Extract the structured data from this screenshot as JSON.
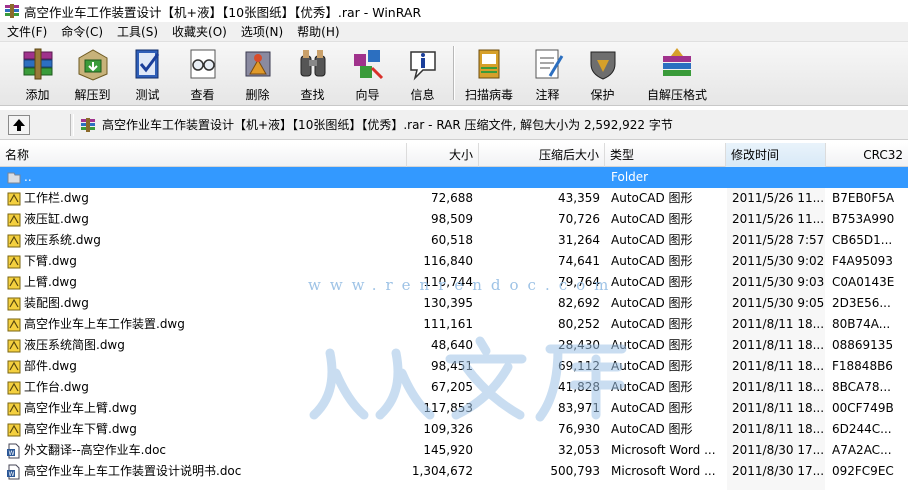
{
  "window": {
    "title": "高空作业车工作装置设计【机+液】【10张图纸】【优秀】.rar - WinRAR"
  },
  "menu": [
    {
      "label": "文件(F)"
    },
    {
      "label": "命令(C)"
    },
    {
      "label": "工具(S)"
    },
    {
      "label": "收藏夹(O)"
    },
    {
      "label": "选项(N)"
    },
    {
      "label": "帮助(H)"
    }
  ],
  "toolbar": [
    {
      "label": "添加",
      "icon": "add-books-icon"
    },
    {
      "label": "解压到",
      "icon": "extract-to-icon"
    },
    {
      "label": "测试",
      "icon": "test-icon"
    },
    {
      "label": "查看",
      "icon": "view-glasses-icon"
    },
    {
      "label": "删除",
      "icon": "delete-icon"
    },
    {
      "label": "查找",
      "icon": "find-binoculars-icon"
    },
    {
      "label": "向导",
      "icon": "wizard-icon"
    },
    {
      "label": "信息",
      "icon": "info-icon"
    },
    {
      "label": "扫描病毒",
      "icon": "virus-scan-icon"
    },
    {
      "label": "注释",
      "icon": "comment-icon"
    },
    {
      "label": "保护",
      "icon": "protect-shield-icon"
    },
    {
      "label": "自解压格式",
      "icon": "sfx-icon"
    }
  ],
  "address": {
    "text": "高空作业车工作装置设计【机+液】【10张图纸】【优秀】.rar - RAR 压缩文件, 解包大小为 2,592,922 字节"
  },
  "columns": {
    "name": "名称",
    "size": "大小",
    "packed": "压缩后大小",
    "type": "类型",
    "modified": "修改时间",
    "crc": "CRC32"
  },
  "rows": [
    {
      "name": "..",
      "size": "",
      "packed": "",
      "type": "Folder",
      "modified": "",
      "crc": "",
      "kind": "folder"
    },
    {
      "name": "工作栏.dwg",
      "size": "72,688",
      "packed": "43,359",
      "type": "AutoCAD 图形",
      "modified": "2011/5/26 11...",
      "crc": "B7EB0F5A",
      "kind": "dwg"
    },
    {
      "name": "液压缸.dwg",
      "size": "98,509",
      "packed": "70,726",
      "type": "AutoCAD 图形",
      "modified": "2011/5/26 11...",
      "crc": "B753A990",
      "kind": "dwg"
    },
    {
      "name": "液压系统.dwg",
      "size": "60,518",
      "packed": "31,264",
      "type": "AutoCAD 图形",
      "modified": "2011/5/28 7:57",
      "crc": "CB65D1...",
      "kind": "dwg"
    },
    {
      "name": "下臂.dwg",
      "size": "116,840",
      "packed": "74,641",
      "type": "AutoCAD 图形",
      "modified": "2011/5/30 9:02",
      "crc": "F4A95093",
      "kind": "dwg"
    },
    {
      "name": "上臂.dwg",
      "size": "110,744",
      "packed": "79,764",
      "type": "AutoCAD 图形",
      "modified": "2011/5/30 9:03",
      "crc": "C0A0143E",
      "kind": "dwg"
    },
    {
      "name": "装配图.dwg",
      "size": "130,395",
      "packed": "82,692",
      "type": "AutoCAD 图形",
      "modified": "2011/5/30 9:05",
      "crc": "2D3E56...",
      "kind": "dwg"
    },
    {
      "name": "高空作业车上车工作装置.dwg",
      "size": "111,161",
      "packed": "80,252",
      "type": "AutoCAD 图形",
      "modified": "2011/8/11 18...",
      "crc": "80B74A...",
      "kind": "dwg"
    },
    {
      "name": "液压系统简图.dwg",
      "size": "48,640",
      "packed": "28,430",
      "type": "AutoCAD 图形",
      "modified": "2011/8/11 18...",
      "crc": "08869135",
      "kind": "dwg"
    },
    {
      "name": "部件.dwg",
      "size": "98,451",
      "packed": "69,112",
      "type": "AutoCAD 图形",
      "modified": "2011/8/11 18...",
      "crc": "F18848B6",
      "kind": "dwg"
    },
    {
      "name": "工作台.dwg",
      "size": "67,205",
      "packed": "41,828",
      "type": "AutoCAD 图形",
      "modified": "2011/8/11 18...",
      "crc": "8BCA78...",
      "kind": "dwg"
    },
    {
      "name": "高空作业车上臂.dwg",
      "size": "117,853",
      "packed": "83,971",
      "type": "AutoCAD 图形",
      "modified": "2011/8/11 18...",
      "crc": "00CF749B",
      "kind": "dwg"
    },
    {
      "name": "高空作业车下臂.dwg",
      "size": "109,326",
      "packed": "76,930",
      "type": "AutoCAD 图形",
      "modified": "2011/8/11 18...",
      "crc": "6D244C...",
      "kind": "dwg"
    },
    {
      "name": "外文翻译--高空作业车.doc",
      "size": "145,920",
      "packed": "32,053",
      "type": "Microsoft Word ...",
      "modified": "2011/8/30 17...",
      "crc": "A7A2AC...",
      "kind": "doc"
    },
    {
      "name": "高空作业车上车工作装置设计说明书.doc",
      "size": "1,304,672",
      "packed": "500,793",
      "type": "Microsoft Word ...",
      "modified": "2011/8/30 17...",
      "crc": "092FC9EC",
      "kind": "doc"
    }
  ],
  "selected_row": 0,
  "watermark": {
    "text": "www.renrendoc.com",
    "glyphs": "人人文库"
  },
  "colors": {
    "selection": "#3399ff",
    "watermark": "#9ec3e6"
  }
}
